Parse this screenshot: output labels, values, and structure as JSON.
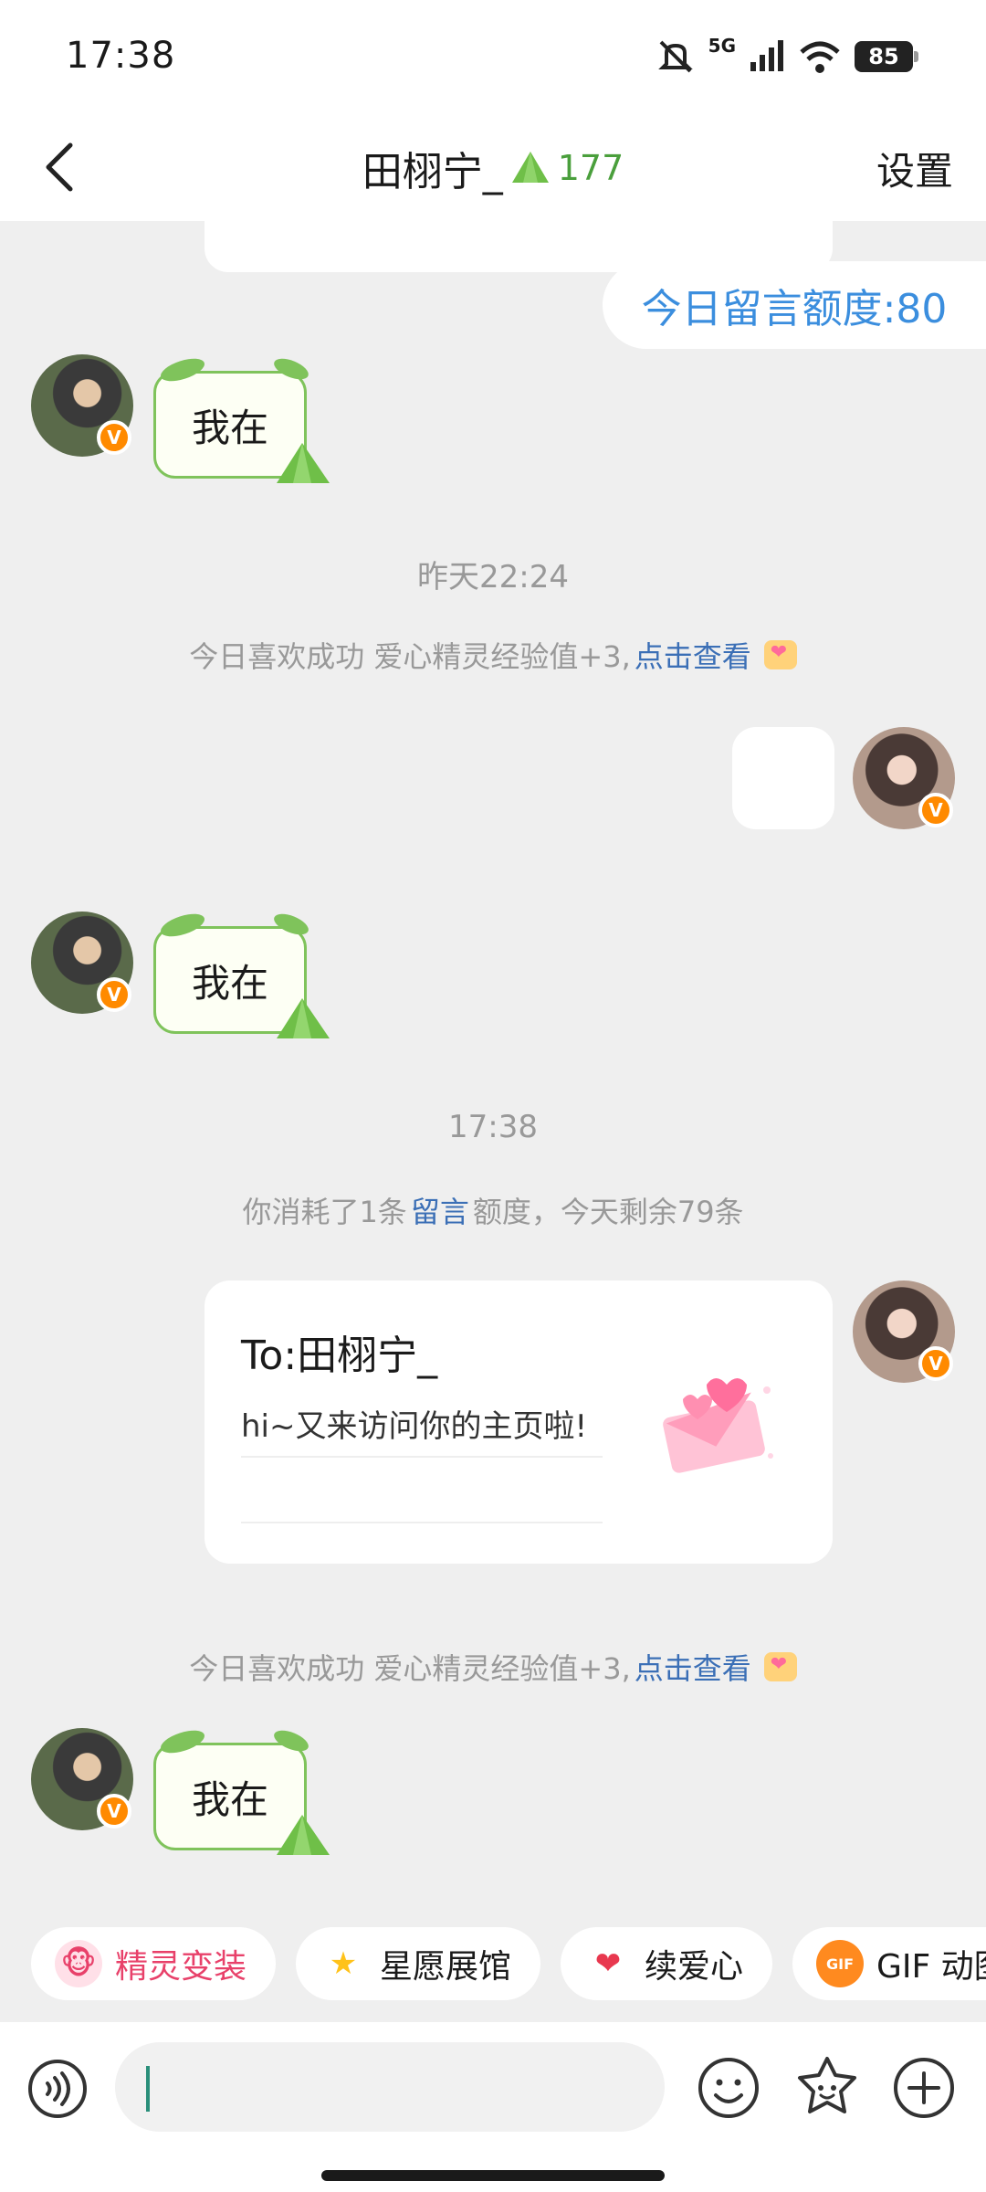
{
  "status_bar": {
    "time": "17:38",
    "network": "5G",
    "battery": "85"
  },
  "nav": {
    "title": "田栩宁_",
    "count": "177",
    "settings_label": "设置"
  },
  "quota_pill": "今日留言额度:80",
  "messages": {
    "reply1": "我在",
    "time1": "昨天22:24",
    "sys1_prefix": "今日喜欢成功 爱心精灵经验值+3,",
    "sys1_link": "点击查看",
    "reply2": "我在",
    "time2": "17:38",
    "sys2_prefix": "你消耗了1条",
    "sys2_link": "留言",
    "sys2_suffix": "额度，今天剩余79条",
    "card_to": "To:田栩宁_",
    "card_msg": "hi~又来访问你的主页啦!",
    "sys3_prefix": "今日喜欢成功 爱心精灵经验值+3,",
    "sys3_link": "点击查看",
    "reply3": "我在"
  },
  "chips": {
    "c1": "精灵变装",
    "c2": "星愿展馆",
    "c3": "续爱心",
    "c4": "GIF 动图"
  },
  "input": {
    "placeholder": ""
  },
  "colors": {
    "accent_blue": "#3b8ede",
    "link_blue": "#3b6fb6",
    "green": "#7fc35b",
    "badge": "#ff8a00",
    "pink": "#e8416a"
  }
}
